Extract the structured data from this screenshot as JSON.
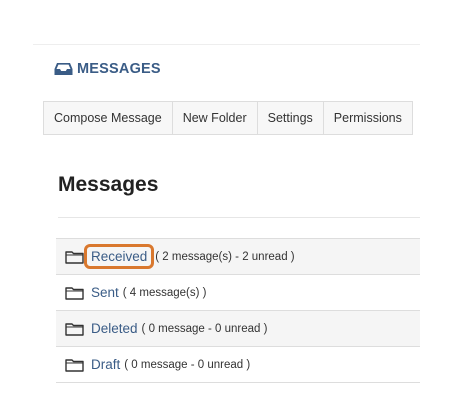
{
  "header": {
    "title": "MESSAGES",
    "icon": "inbox-icon"
  },
  "menu": {
    "tabs": [
      {
        "label": "Compose Message"
      },
      {
        "label": "New Folder"
      },
      {
        "label": "Settings"
      },
      {
        "label": "Permissions"
      }
    ]
  },
  "main": {
    "heading": "Messages",
    "folders": [
      {
        "name": "Received",
        "meta": "( 2 message(s) - 2 unread )",
        "highlighted": true
      },
      {
        "name": "Sent",
        "meta": "( 4 message(s) )",
        "highlighted": false
      },
      {
        "name": "Deleted",
        "meta": "( 0 message - 0 unread )",
        "highlighted": false
      },
      {
        "name": "Draft",
        "meta": "( 0 message - 0 unread )",
        "highlighted": false
      }
    ]
  },
  "colors": {
    "link": "#3a5c86",
    "highlight": "#d9782e"
  }
}
